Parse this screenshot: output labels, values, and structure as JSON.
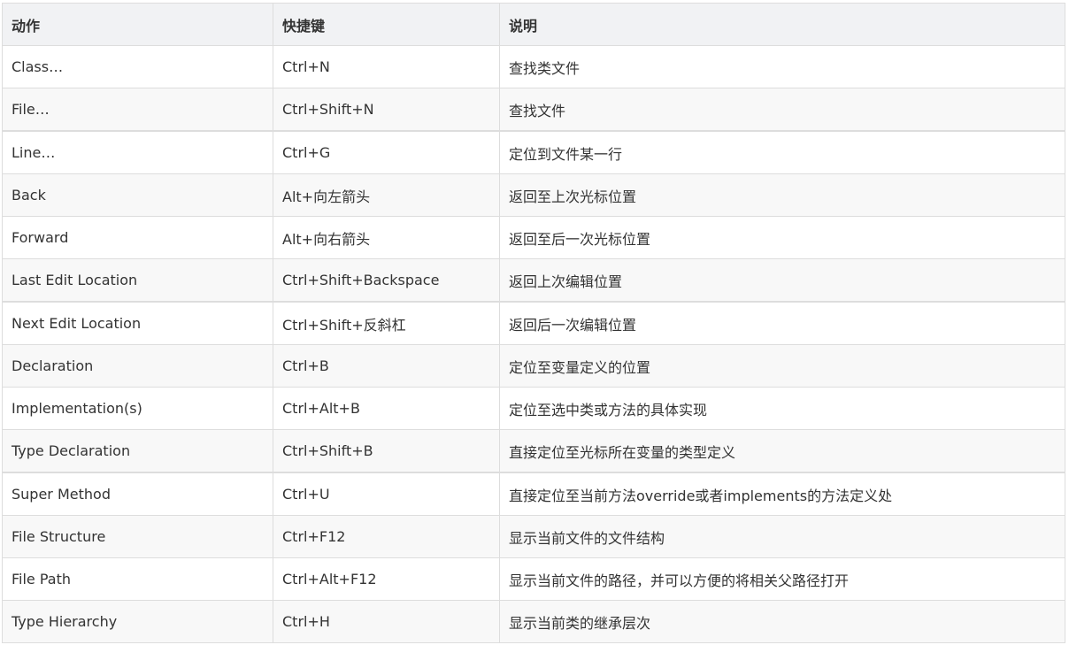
{
  "table": {
    "headers": [
      "动作",
      "快捷键",
      "说明"
    ],
    "rows": [
      {
        "action": "Class…",
        "shortcut": "Ctrl+N",
        "description": "查找类文件"
      },
      {
        "action": "File…",
        "shortcut": "Ctrl+Shift+N",
        "description": "查找文件"
      },
      {
        "action": "Line…",
        "shortcut": "Ctrl+G",
        "description": "定位到文件某一行"
      },
      {
        "action": "Back",
        "shortcut": "Alt+向左箭头",
        "description": "返回至上次光标位置"
      },
      {
        "action": "Forward",
        "shortcut": "Alt+向右箭头",
        "description": "返回至后一次光标位置"
      },
      {
        "action": "Last Edit Location",
        "shortcut": "Ctrl+Shift+Backspace",
        "description": "返回上次编辑位置"
      },
      {
        "action": "Next Edit Location",
        "shortcut": "Ctrl+Shift+反斜杠",
        "description": "返回后一次编辑位置"
      },
      {
        "action": "Declaration",
        "shortcut": "Ctrl+B",
        "description": "定位至变量定义的位置"
      },
      {
        "action": "Implementation(s)",
        "shortcut": "Ctrl+Alt+B",
        "description": "定位至选中类或方法的具体实现"
      },
      {
        "action": "Type Declaration",
        "shortcut": "Ctrl+Shift+B",
        "description": "直接定位至光标所在变量的类型定义"
      },
      {
        "action": "Super Method",
        "shortcut": "Ctrl+U",
        "description": "直接定位至当前方法override或者implements的方法定义处"
      },
      {
        "action": "File Structure",
        "shortcut": "Ctrl+F12",
        "description": "显示当前文件的文件结构"
      },
      {
        "action": "File Path",
        "shortcut": "Ctrl+Alt+F12",
        "description": "显示当前文件的路径，并可以方便的将相关父路径打开"
      },
      {
        "action": "Type Hierarchy",
        "shortcut": "Ctrl+H",
        "description": "显示当前类的继承层次"
      }
    ]
  },
  "colors": {
    "header_bg": "#f1f2f4",
    "stripe_bg": "#f8f8f8",
    "border": "#dddddd",
    "text": "#333333"
  }
}
